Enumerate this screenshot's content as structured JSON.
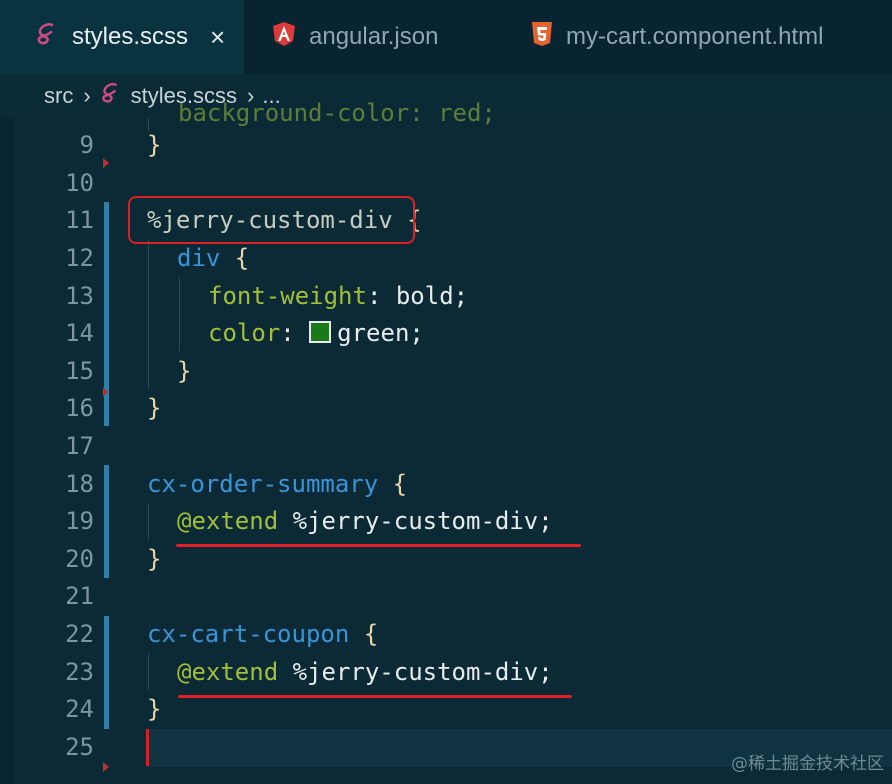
{
  "tabs": [
    {
      "label": "styles.scss",
      "icon": "sass-icon",
      "active": true,
      "close": "×"
    },
    {
      "label": "angular.json",
      "icon": "angular-icon",
      "active": false
    },
    {
      "label": "my-cart.component.html",
      "icon": "html5-icon",
      "active": false
    }
  ],
  "breadcrumb": {
    "folder": "src",
    "file": "styles.scss",
    "more": "..."
  },
  "code": {
    "partial_top": "background-color: red;",
    "l9": "}",
    "l11_sel": "%jerry-custom-div",
    "l11_brace": " {",
    "l12_kw": "div",
    "l12_brace": " {",
    "l13_prop": "font-weight",
    "l13_val": ": bold;",
    "l14_prop": "color",
    "l14_colon": ": ",
    "l14_val": "green;",
    "l15": "}",
    "l16": "}",
    "l18_kw": "cx-order-summary",
    "l18_brace": " {",
    "l19_at": "@extend",
    "l19_val": " %jerry-custom-div;",
    "l20": "}",
    "l22_kw": "cx-cart-coupon",
    "l22_brace": " {",
    "l23_at": "@extend",
    "l23_val": " %jerry-custom-div;",
    "l24": "}"
  },
  "line_numbers": [
    "9",
    "10",
    "11",
    "12",
    "13",
    "14",
    "15",
    "16",
    "17",
    "18",
    "19",
    "20",
    "21",
    "22",
    "23",
    "24",
    "25"
  ],
  "colors": {
    "swatch": "#1a7a1a",
    "highlight": "#e01e25"
  },
  "watermark": "@稀土掘金技术社区"
}
